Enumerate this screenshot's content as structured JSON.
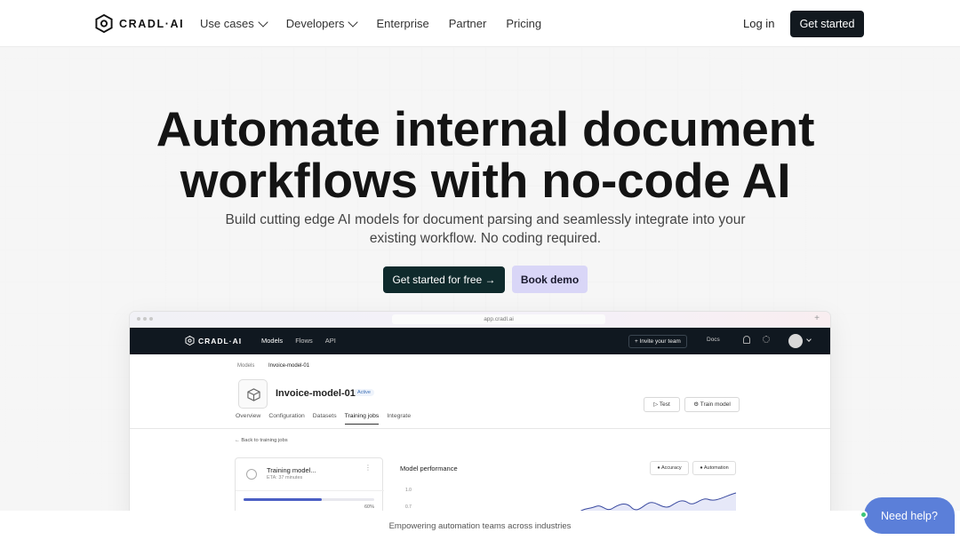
{
  "nav": {
    "logo_text": "CRADL·AI",
    "links": [
      "Use cases",
      "Developers",
      "Enterprise",
      "Partner",
      "Pricing"
    ],
    "login": "Log in",
    "get_started": "Get started"
  },
  "hero": {
    "headline_line1": "Automate internal document",
    "headline_line2": "workflows with no-code AI",
    "sub_line1": "Build cutting edge AI models for document parsing and seamlessly integrate into your",
    "sub_line2": "existing workflow. No coding required.",
    "cta_primary": "Get started for free →",
    "cta_secondary": "Book demo"
  },
  "mockup": {
    "url": "app.cradl.ai",
    "app_logo": "CRADL·AI",
    "app_nav": [
      "Models",
      "Flows",
      "API"
    ],
    "invite": "+ Invite your team",
    "docs": "Docs",
    "breadcrumb_root": "Models",
    "breadcrumb_current": "Invoice-model-01",
    "model_name": "Invoice-model-01",
    "status": "Active",
    "test_label": "Test",
    "train_label": "Train model",
    "tabs": [
      "Overview",
      "Configuration",
      "Datasets",
      "Training jobs",
      "Integrate"
    ],
    "back_link": "Back to training jobs",
    "training": {
      "title": "Training model...",
      "eta": "ETA: 37 minutes",
      "progress": 0.6,
      "progress_label": "60%"
    },
    "performance": {
      "title": "Model performance",
      "legend": [
        "Accuracy",
        "Automation"
      ],
      "ticks": [
        "1.0",
        "0.7"
      ]
    }
  },
  "footer": {
    "strip_text": "Empowering automation teams across industries",
    "help": "Need help?"
  },
  "colors": {
    "primary_dark": "#0f2a2c",
    "secondary_lavender": "#d9d6f7",
    "help_blue": "#5b7fd9",
    "online_green": "#3cc67a"
  }
}
